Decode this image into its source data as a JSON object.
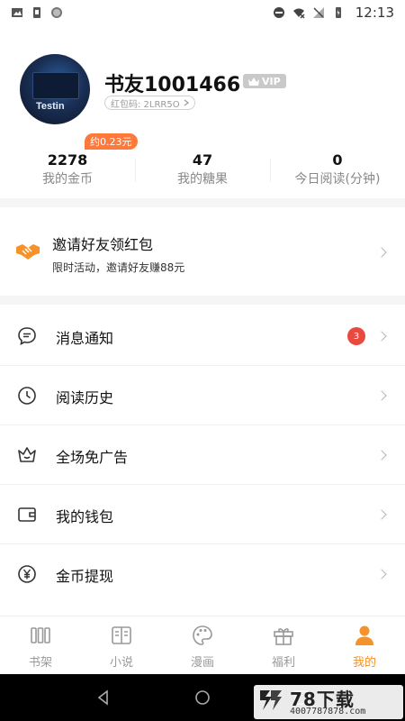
{
  "status_bar": {
    "time": "12:13",
    "left_icons": [
      "image-icon",
      "sim-icon",
      "circle-icon"
    ],
    "right_icons": [
      "dnd-icon",
      "wifi-off-icon",
      "no-signal-icon",
      "battery-icon"
    ]
  },
  "profile": {
    "avatar_text": "Testin",
    "username": "书友1001466",
    "vip_label": "VIP",
    "red_packet_code": "红包码: 2LRR5O"
  },
  "stats": {
    "coin_tag": "约0.23元",
    "items": [
      {
        "value": "2278",
        "label": "我的金币"
      },
      {
        "value": "47",
        "label": "我的糖果"
      },
      {
        "value": "0",
        "label": "今日阅读(分钟)"
      }
    ]
  },
  "invite": {
    "title": "邀请好友领红包",
    "subtitle": "限时活动，邀请好友赚88元"
  },
  "menu": {
    "items": [
      {
        "label": "消息通知",
        "icon": "message-icon",
        "badge": "3"
      },
      {
        "label": "阅读历史",
        "icon": "clock-icon"
      },
      {
        "label": "全场免广告",
        "icon": "crown-icon"
      },
      {
        "label": "我的钱包",
        "icon": "wallet-icon"
      },
      {
        "label": "金币提现",
        "icon": "yen-icon"
      }
    ]
  },
  "tabbar": {
    "items": [
      {
        "label": "书架",
        "icon": "bookshelf-icon"
      },
      {
        "label": "小说",
        "icon": "book-icon"
      },
      {
        "label": "漫画",
        "icon": "palette-icon"
      },
      {
        "label": "福利",
        "icon": "gift-icon"
      },
      {
        "label": "我的",
        "icon": "person-icon",
        "active": true
      }
    ]
  },
  "watermark": {
    "title": "78下载",
    "phone": "4007787878.com"
  },
  "colors": {
    "accent": "#f5922a",
    "coin_tag": "#ff7a3a",
    "badge": "#e94a3f"
  }
}
